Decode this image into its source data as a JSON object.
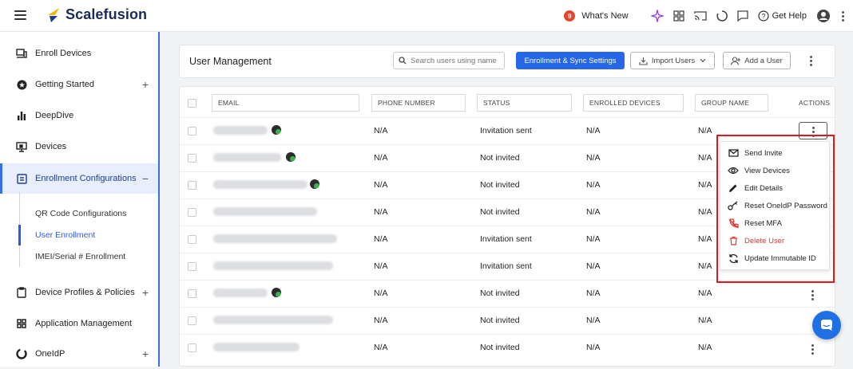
{
  "app": {
    "name": "Scalefusion"
  },
  "topbar": {
    "whats_new_count": "9",
    "whats_new": "What's New",
    "help": "Get Help"
  },
  "sidebar": {
    "items": [
      {
        "label": "Enroll Devices"
      },
      {
        "label": "Getting Started"
      },
      {
        "label": "DeepDive"
      },
      {
        "label": "Devices"
      },
      {
        "label": "Enrollment Configurations"
      },
      {
        "label": "Device Profiles & Policies"
      },
      {
        "label": "Application Management"
      },
      {
        "label": "OneIdP"
      }
    ],
    "expand": "+",
    "collapse": "−",
    "subitems": [
      {
        "label": "QR Code Configurations"
      },
      {
        "label": "User Enrollment"
      },
      {
        "label": "IMEI/Serial # Enrollment"
      }
    ]
  },
  "header": {
    "title": "User Management",
    "search_placeholder": "Search users using name or email",
    "sync_button": "Enrollment & Sync Settings",
    "import_button": "Import Users",
    "add_button": "Add a User"
  },
  "table": {
    "columns": [
      "EMAIL",
      "PHONE NUMBER",
      "STATUS",
      "ENROLLED DEVICES",
      "GROUP NAME",
      "ACTIONS"
    ],
    "rows": [
      {
        "phone": "N/A",
        "status": "Invitation sent",
        "devices": "N/A",
        "group": "N/A"
      },
      {
        "phone": "N/A",
        "status": "Not invited",
        "devices": "N/A",
        "group": "N/A"
      },
      {
        "phone": "N/A",
        "status": "Not invited",
        "devices": "N/A",
        "group": "N/A"
      },
      {
        "phone": "N/A",
        "status": "Not invited",
        "devices": "N/A",
        "group": "N/A"
      },
      {
        "phone": "N/A",
        "status": "Invitation sent",
        "devices": "N/A",
        "group": "N/A"
      },
      {
        "phone": "N/A",
        "status": "Invitation sent",
        "devices": "N/A",
        "group": "N/A"
      },
      {
        "phone": "N/A",
        "status": "Not invited",
        "devices": "N/A",
        "group": "N/A"
      },
      {
        "phone": "N/A",
        "status": "Not invited",
        "devices": "N/A",
        "group": "N/A"
      },
      {
        "phone": "N/A",
        "status": "Not invited",
        "devices": "N/A",
        "group": "N/A"
      }
    ]
  },
  "actions_menu": {
    "items": [
      {
        "label": "Send Invite",
        "icon": "mail-icon"
      },
      {
        "label": "View Devices",
        "icon": "eye-icon"
      },
      {
        "label": "Edit Details",
        "icon": "pencil-icon"
      },
      {
        "label": "Reset OneIdP Password",
        "icon": "key-icon"
      },
      {
        "label": "Reset MFA",
        "icon": "mfa-reset-icon"
      },
      {
        "label": "Delete User",
        "icon": "trash-icon"
      },
      {
        "label": "Update Immutable ID",
        "icon": "sync-icon"
      }
    ]
  },
  "colors": {
    "primary": "#2667e8",
    "danger": "#d93a3a",
    "highlight": "#e3161b"
  }
}
